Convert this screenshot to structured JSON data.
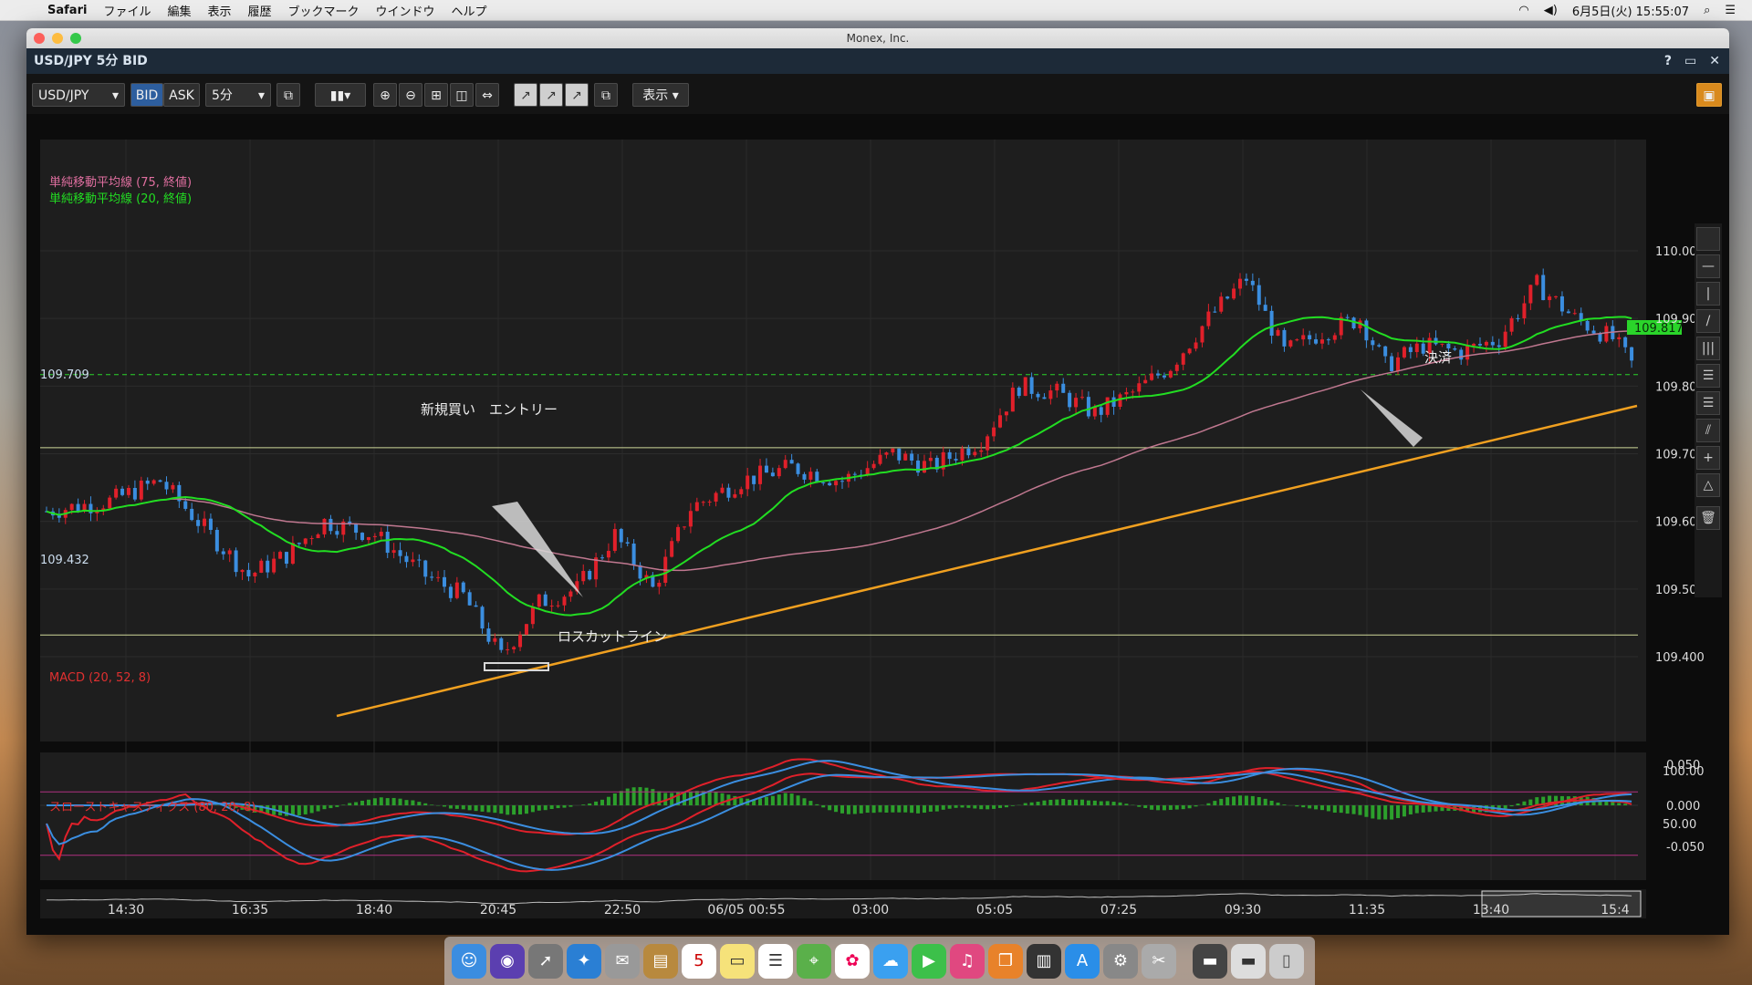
{
  "menubar": {
    "app": "Safari",
    "items": [
      "ファイル",
      "編集",
      "表示",
      "履歴",
      "ブックマーク",
      "ウインドウ",
      "ヘルプ"
    ],
    "datetime": "6月5日(火) 15:55:07"
  },
  "window": {
    "site_title": "Monex, Inc.",
    "app_title": "USD/JPY 5分 BID",
    "controls": [
      "?",
      "▭",
      "✕"
    ]
  },
  "toolbar": {
    "symbol": "USD/JPY",
    "bid": "BID",
    "ask": "ASK",
    "interval": "5分",
    "display": "表示"
  },
  "chart": {
    "legend_sma75": "単純移動平均線 (75, 終値)",
    "legend_sma20": "単純移動平均線 (20, 終値)",
    "macd_label": "MACD (20, 52, 8)",
    "stoch_label": "スローストキャスティクス (80, 20, 8)",
    "current_price": "109.817",
    "line_high": "109.709",
    "line_low": "109.432",
    "annotation_entry": "新規買い　エントリー",
    "annotation_exit": "決済",
    "annotation_stop": "ロスカットライン",
    "price_ticks": [
      "110.000",
      "109.900",
      "109.800",
      "109.700",
      "109.600",
      "109.500",
      "109.400"
    ],
    "macd_ticks": [
      "0.050",
      "0.000",
      "-0.050"
    ],
    "stoch_ticks": [
      "100.00",
      "50.00"
    ],
    "time_ticks": [
      "14:30",
      "16:35",
      "18:40",
      "20:45",
      "22:50",
      "06/05 00:55",
      "03:00",
      "05:05",
      "07:25",
      "09:30",
      "11:35",
      "13:40",
      "15:4"
    ]
  },
  "colors": {
    "up": "#e0202a",
    "down": "#3b8ee0",
    "sma20": "#22dd22",
    "sma75": "#c07890",
    "trend": "#f0a020"
  }
}
